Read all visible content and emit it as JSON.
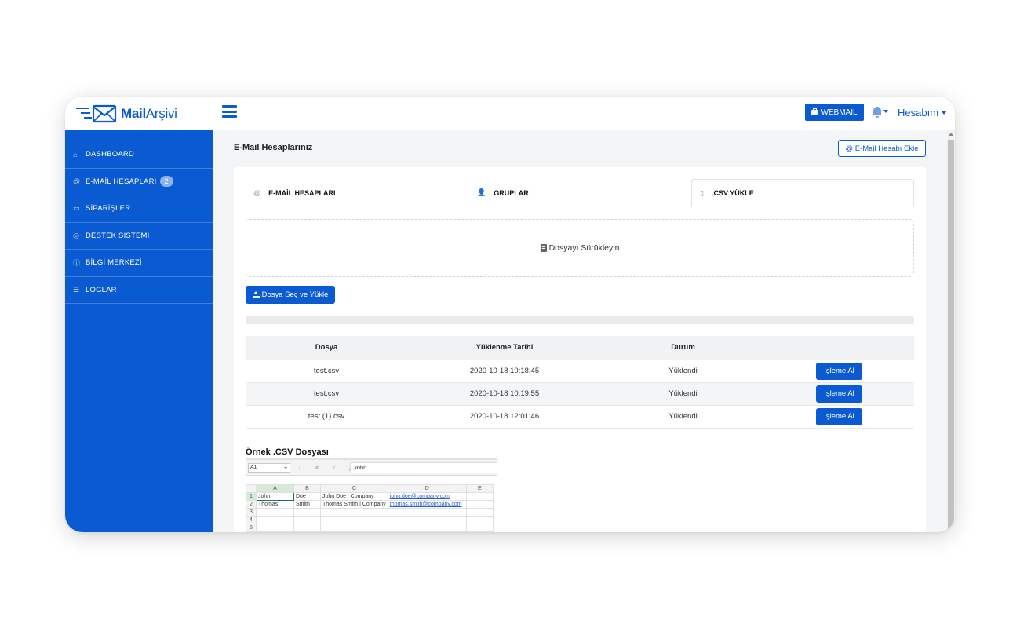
{
  "brand": {
    "name_bold": "Mail",
    "name_light": "Arşivi"
  },
  "header": {
    "webmail_label": "WEBMAIL",
    "account_label": "Hesabım"
  },
  "sidebar": {
    "items": [
      {
        "label": "DASHBOARD",
        "icon": "home-icon"
      },
      {
        "label": "E-MAİL HESAPLARI",
        "icon": "at-icon",
        "badge": "2"
      },
      {
        "label": "SİPARİŞLER",
        "icon": "credit-card-icon"
      },
      {
        "label": "DESTEK SİSTEMİ",
        "icon": "globe-icon"
      },
      {
        "label": "BİLGİ MERKEZİ",
        "icon": "info-icon"
      },
      {
        "label": "LOGLAR",
        "icon": "list-icon"
      }
    ]
  },
  "main": {
    "title": "E-Mail Hesaplarınız",
    "add_button": "@ E-Mail Hesabı Ekle",
    "tabs": [
      {
        "label": "E-MAİL HESAPLARI",
        "icon": "at-icon"
      },
      {
        "label": "GRUPLAR",
        "icon": "users-icon"
      },
      {
        "label": ".CSV YÜKLE",
        "icon": "file-icon",
        "active": true
      }
    ],
    "dropzone_text": "Dosyayı Sürükleyin",
    "upload_button": "Dosya Seç ve Yükle",
    "progress": 0,
    "table": {
      "headers": [
        "Dosya",
        "Yüklenme Tarihi",
        "Durum",
        ""
      ],
      "rows": [
        {
          "file": "test.csv",
          "date": "2020-10-18 10:18:45",
          "status": "Yüklendi",
          "action": "İşleme Al"
        },
        {
          "file": "test.csv",
          "date": "2020-10-18 10:19:55",
          "status": "Yüklendi",
          "action": "İşleme Al"
        },
        {
          "file": "test (1).csv",
          "date": "2020-10-18 12:01:46",
          "status": "Yüklendi",
          "action": "İşleme Al"
        }
      ]
    },
    "sample": {
      "title": "Örnek .CSV Dosyası",
      "name_box": "A1",
      "formula_value": "John",
      "columns": [
        "A",
        "B",
        "C",
        "D",
        "E"
      ],
      "rows": [
        [
          "1",
          "John",
          "Doe",
          "John Doe | Company",
          "john.doe@company.com",
          ""
        ],
        [
          "2",
          "Thomas",
          "Smith",
          "Thomas Smith | Company",
          "thomas.smith@company.com",
          ""
        ],
        [
          "3",
          "",
          "",
          "",
          "",
          ""
        ],
        [
          "4",
          "",
          "",
          "",
          "",
          ""
        ],
        [
          "5",
          "",
          "",
          "",
          "",
          ""
        ]
      ]
    }
  },
  "colors": {
    "primary": "#0a5bd1",
    "sidebar": "#0a5bd1",
    "badge": "#8bb3ea"
  }
}
